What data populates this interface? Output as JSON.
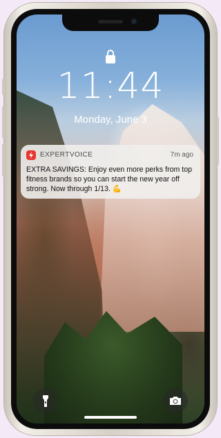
{
  "lock_screen": {
    "time": "11:44",
    "date": "Monday, June 3"
  },
  "notification": {
    "app_name": "EXPERTVOICE",
    "time_ago": "7m ago",
    "message": "EXTRA SAVINGS: Enjoy even more perks from top fitness brands so you can start the new year off strong. Now through 1/13. 💪",
    "app_icon_color": "#e7372e"
  },
  "quick_actions": {
    "left_icon": "flashlight-icon",
    "right_icon": "camera-icon"
  },
  "icons": {
    "lock": "lock-icon"
  }
}
